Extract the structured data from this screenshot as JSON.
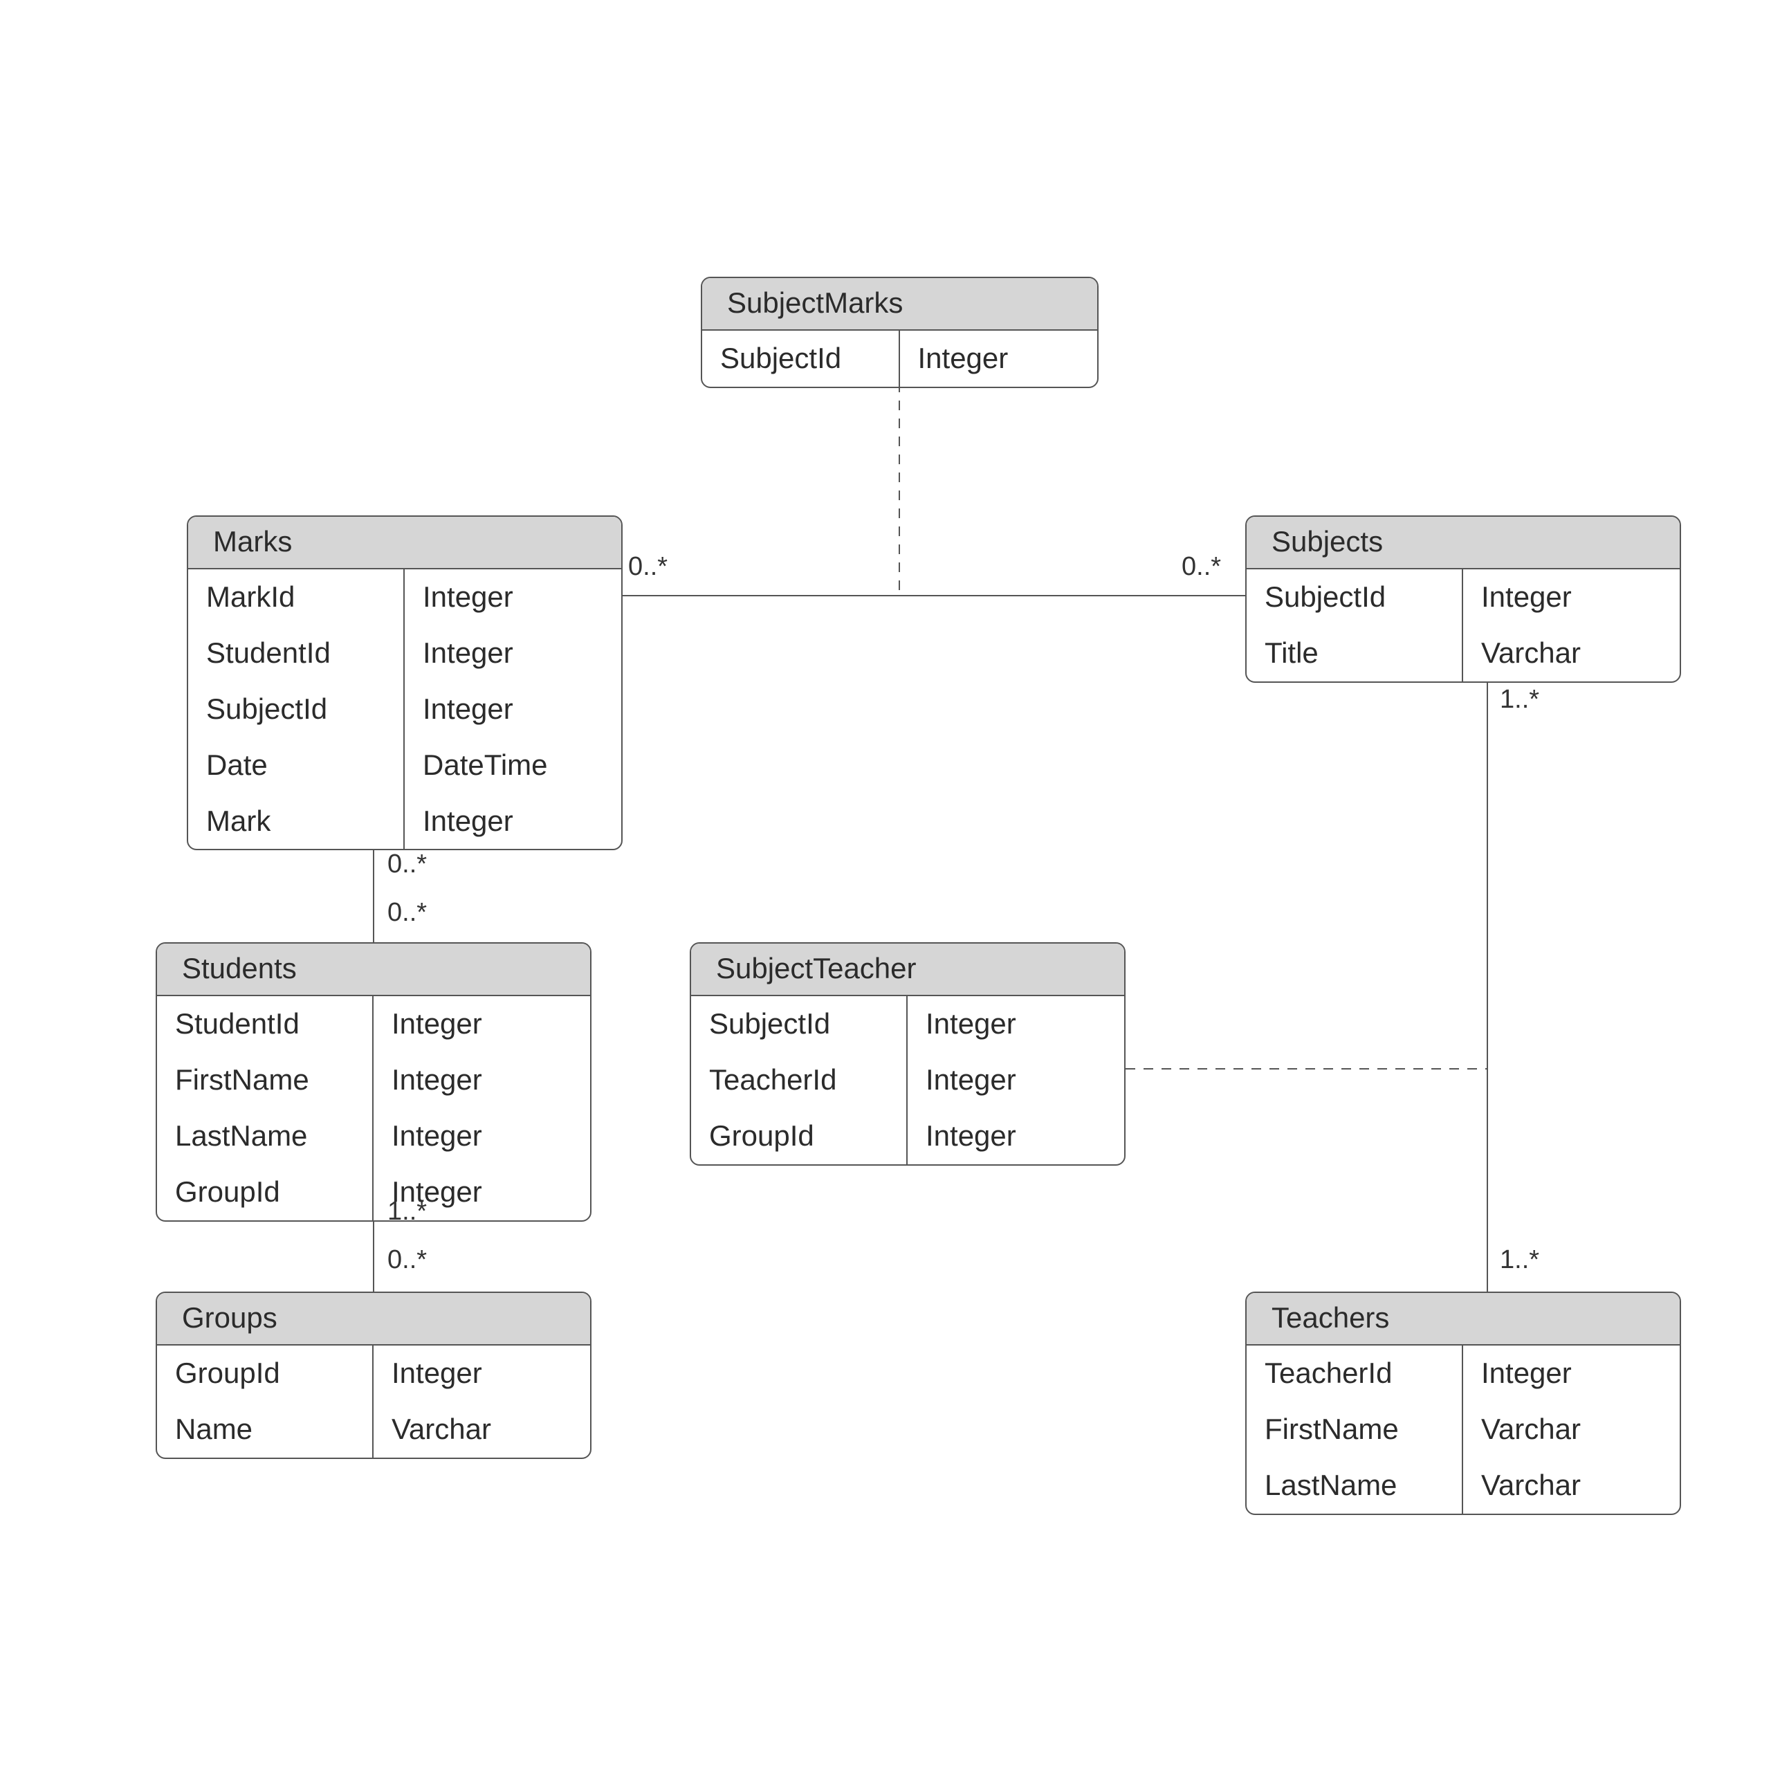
{
  "entities": {
    "subjectMarks": {
      "title": "SubjectMarks",
      "fields": [
        {
          "name": "SubjectId",
          "type": "Integer"
        }
      ]
    },
    "marks": {
      "title": "Marks",
      "fields": [
        {
          "name": "MarkId",
          "type": "Integer"
        },
        {
          "name": "StudentId",
          "type": "Integer"
        },
        {
          "name": "SubjectId",
          "type": "Integer"
        },
        {
          "name": "Date",
          "type": "DateTime"
        },
        {
          "name": "Mark",
          "type": "Integer"
        }
      ]
    },
    "subjects": {
      "title": "Subjects",
      "fields": [
        {
          "name": "SubjectId",
          "type": "Integer"
        },
        {
          "name": "Title",
          "type": "Varchar"
        }
      ]
    },
    "students": {
      "title": "Students",
      "fields": [
        {
          "name": "StudentId",
          "type": "Integer"
        },
        {
          "name": "FirstName",
          "type": "Integer"
        },
        {
          "name": "LastName",
          "type": "Integer"
        },
        {
          "name": "GroupId",
          "type": "Integer"
        }
      ]
    },
    "subjectTeacher": {
      "title": "SubjectTeacher",
      "fields": [
        {
          "name": "SubjectId",
          "type": "Integer"
        },
        {
          "name": "TeacherId",
          "type": "Integer"
        },
        {
          "name": "GroupId",
          "type": "Integer"
        }
      ]
    },
    "groups": {
      "title": "Groups",
      "fields": [
        {
          "name": "GroupId",
          "type": "Integer"
        },
        {
          "name": "Name",
          "type": "Varchar"
        }
      ]
    },
    "teachers": {
      "title": "Teachers",
      "fields": [
        {
          "name": "TeacherId",
          "type": "Integer"
        },
        {
          "name": "FirstName",
          "type": "Varchar"
        },
        {
          "name": "LastName",
          "type": "Varchar"
        }
      ]
    }
  },
  "multiplicities": {
    "marks_right": "0..*",
    "subjects_left": "0..*",
    "marks_bottom": "0..*",
    "students_top": "0..*",
    "students_bottom": "1..*",
    "groups_top": "0..*",
    "subjects_bottom": "1..*",
    "teachers_top": "1..*"
  }
}
